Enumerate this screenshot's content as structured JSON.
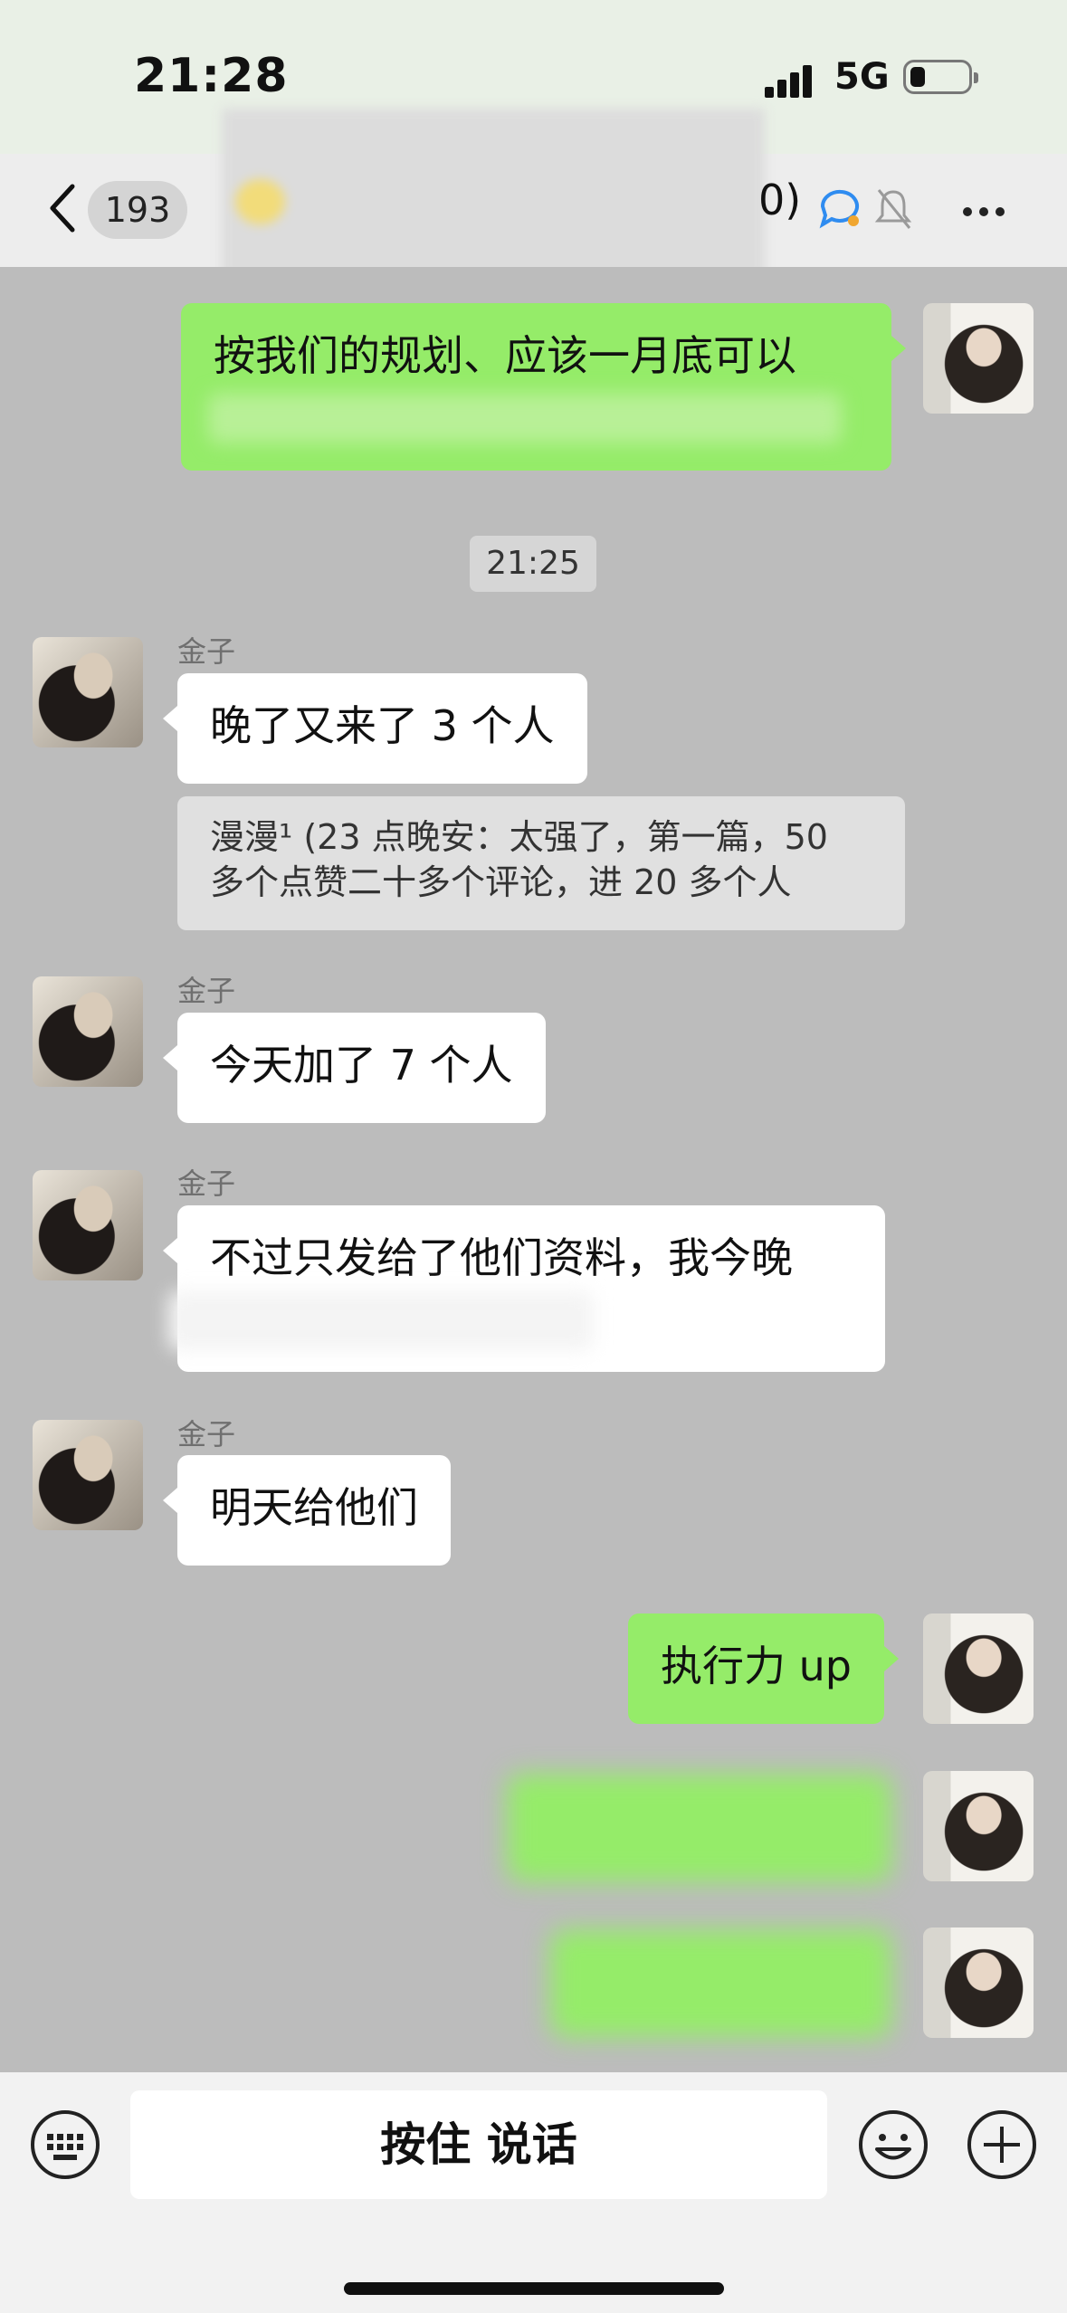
{
  "status_bar": {
    "time": "21:28",
    "network": "5G"
  },
  "header": {
    "unread_count": "193",
    "title_visible_tail": "0)"
  },
  "messages": {
    "m1_text": "按我们的规划、应该一月底可以",
    "timestamp": "21:25",
    "m2_sender": "金子",
    "m2_text": "晚了又来了 3 个人",
    "m2_quote": "漫漫¹ (23 点晚安：太强了，第一篇，50 多个点赞二十多个评论，进 20 多个人",
    "m3_sender": "金子",
    "m3_text": "今天加了 7 个人",
    "m4_sender": "金子",
    "m4_text": "不过只发给了他们资料，我今晚",
    "m5_sender": "金子",
    "m5_text": "明天给他们",
    "m6_text": "执行力 up"
  },
  "input_bar": {
    "hold_to_talk": "按住 说话"
  },
  "colors": {
    "own_bubble": "#95ec69",
    "other_bubble": "#ffffff",
    "chat_background": "#bcbcbc"
  },
  "icons": [
    "back-chevron-icon",
    "ai-chat-icon",
    "mute-bell-icon",
    "more-icon",
    "keyboard-icon",
    "emoji-icon",
    "plus-icon"
  ]
}
